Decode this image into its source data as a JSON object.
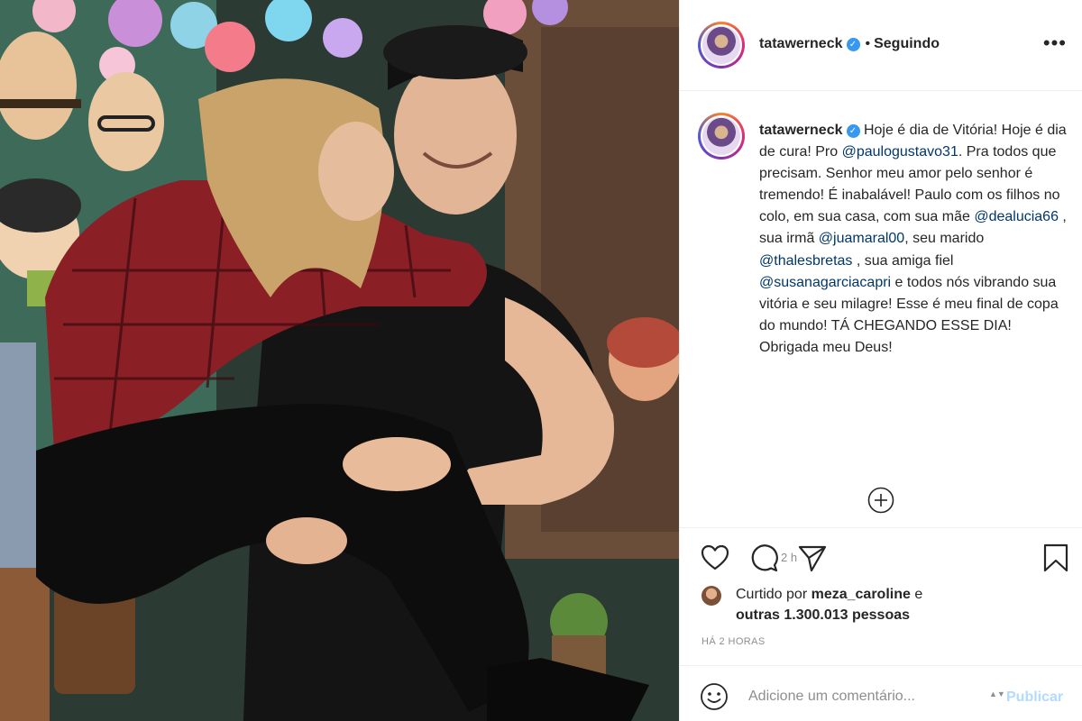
{
  "header": {
    "username": "tatawerneck",
    "dot": "•",
    "follow_status": "Seguindo",
    "more": "•••",
    "avatar_icon": "profile-avatar",
    "verified_icon": "verified-badge"
  },
  "caption": {
    "username": "tatawerneck",
    "segments": [
      {
        "type": "text",
        "text": " Hoje é dia de Vitória! Hoje é dia de cura! Pro "
      },
      {
        "type": "mention",
        "text": "@paulogustavo31"
      },
      {
        "type": "text",
        "text": ". Pra todos que precisam. Senhor meu amor pelo senhor é tremendo! É inabalável! Paulo com os filhos no colo, em sua casa, com sua mãe "
      },
      {
        "type": "mention",
        "text": "@dealucia66"
      },
      {
        "type": "text",
        "text": " , sua irmã "
      },
      {
        "type": "mention",
        "text": "@juamaral00"
      },
      {
        "type": "text",
        "text": ", seu marido "
      },
      {
        "type": "mention",
        "text": "@thalesbretas"
      },
      {
        "type": "text",
        "text": " , sua amiga fiel "
      },
      {
        "type": "mention",
        "text": "@susanagarciacapri"
      },
      {
        "type": "text",
        "text": " e todos nós vibrando sua vitória e seu milagre! Esse é meu final de copa do mundo! TÁ CHEGANDO ESSE DIA! Obrigada meu Deus!"
      }
    ],
    "time": "2 h"
  },
  "likes": {
    "prefix": "Curtido por ",
    "user": "meza_caroline",
    "connector": " e",
    "others": "outras 1.300.013 pessoas"
  },
  "timestamp": "HÁ 2 HORAS",
  "comment": {
    "placeholder": "Adicione um comentário...",
    "publish": "Publicar",
    "spinner": "▲▼"
  },
  "icons": [
    "heart-icon",
    "comment-icon",
    "share-icon",
    "bookmark-icon",
    "add-circle-icon",
    "emoji-icon"
  ]
}
